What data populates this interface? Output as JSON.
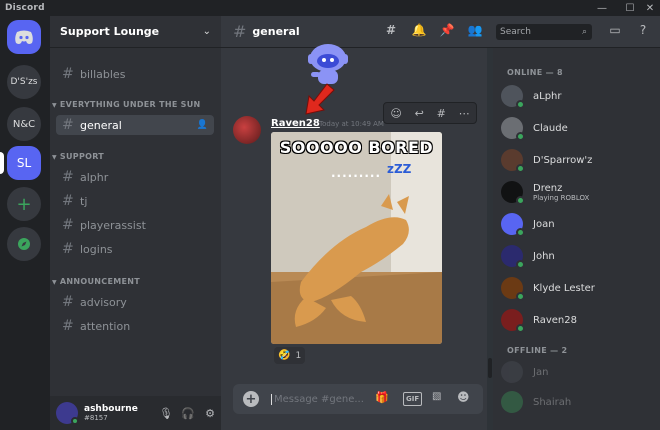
{
  "window": {
    "app_name": "Discord",
    "controls": [
      "—",
      "☐",
      "✕"
    ]
  },
  "servers": [
    {
      "label": "D'S'zs"
    },
    {
      "label": "N&C"
    },
    {
      "label": "SL"
    }
  ],
  "guild": {
    "name": "Support Lounge"
  },
  "channels": {
    "top": [
      {
        "name": "billables"
      }
    ],
    "categories": [
      {
        "name": "EVERYTHING UNDER THE SUN",
        "channels": [
          {
            "name": "general"
          }
        ]
      },
      {
        "name": "SUPPORT",
        "channels": [
          {
            "name": "alphr"
          },
          {
            "name": "tj"
          },
          {
            "name": "playerassist"
          },
          {
            "name": "logins"
          }
        ]
      },
      {
        "name": "ANNOUNCEMENT",
        "channels": [
          {
            "name": "advisory"
          },
          {
            "name": "attention"
          }
        ]
      }
    ]
  },
  "user": {
    "name": "ashbourne",
    "tag": "#8157"
  },
  "topbar": {
    "channel": "general",
    "search_placeholder": "Search"
  },
  "message": {
    "author": "Raven28",
    "timestamp": "Today at 10:49 AM",
    "gif_caption": "SOOOOO BORED",
    "gif_dots": ".........",
    "gif_zzz": "zZZ",
    "reaction": {
      "emoji": "🤣",
      "count": "1"
    }
  },
  "composer": {
    "placeholder": "Message #gene...",
    "gif_label": "GIF"
  },
  "members": {
    "online_header": "ONLINE — 8",
    "offline_header": "OFFLINE — 2",
    "online": [
      {
        "name": "aLphr",
        "color": "#4f545c"
      },
      {
        "name": "Claude",
        "color": "#6b6e73"
      },
      {
        "name": "D'Sparrow'z",
        "color": "#5a3b2e"
      },
      {
        "name": "Drenz",
        "sub": "Playing ROBLOX",
        "color": "#111213"
      },
      {
        "name": "Joan",
        "color": "#5865f2"
      },
      {
        "name": "John",
        "color": "#2b2a6e"
      },
      {
        "name": "Klyde Lester",
        "color": "#6b3a14"
      },
      {
        "name": "Raven28",
        "color": "#7a1e1e"
      }
    ],
    "offline": [
      {
        "name": "Jan",
        "color": "#4f545c"
      },
      {
        "name": "Shairah",
        "color": "#3ba55d"
      }
    ]
  }
}
